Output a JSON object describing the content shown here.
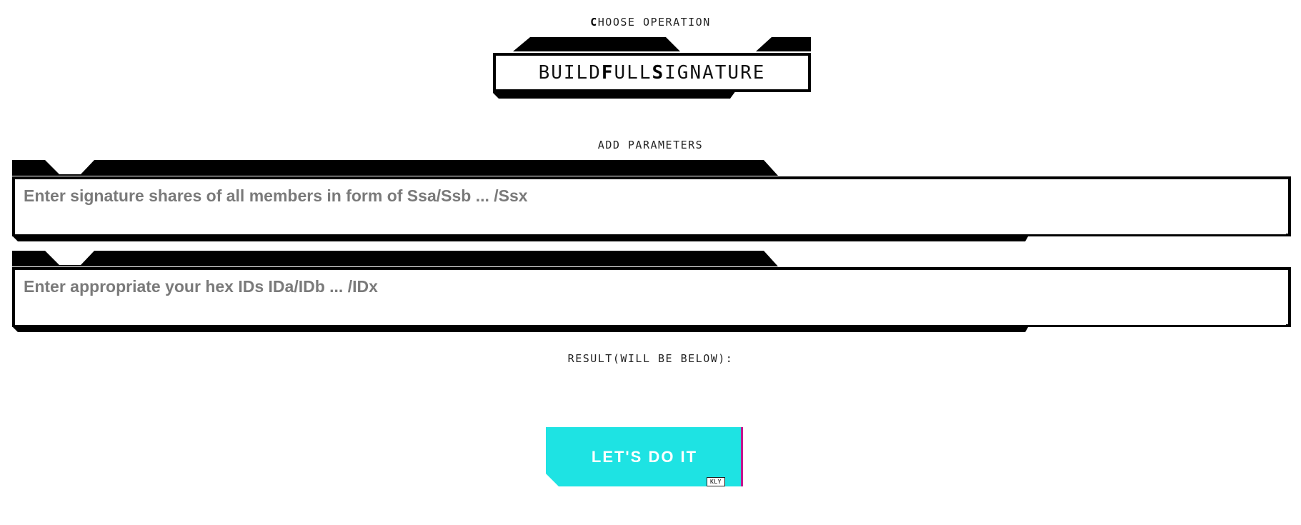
{
  "operation": {
    "label_first": "C",
    "label_rest": "HOOSE OPERATION",
    "selected_parts": [
      "BUILD",
      "F",
      "ULL",
      "S",
      "IGNATURE"
    ]
  },
  "parameters": {
    "label_first": "A",
    "label_rest": "DD PARAMETERS",
    "shares_placeholder": "Enter signature shares of all members in form of Ssa/Ssb ... /Ssx",
    "ids_placeholder": "Enter appropriate your hex IDs IDa/IDb ... /IDx"
  },
  "result": {
    "label_first": "R",
    "label_rest": "ESULT(WILL BE BELOW):"
  },
  "action": {
    "button_label": "LET'S DO IT",
    "button_tag": "KLY"
  },
  "colors": {
    "frame": "#000000",
    "button": "#1ee3e3",
    "button_edge": "#c2188f"
  }
}
